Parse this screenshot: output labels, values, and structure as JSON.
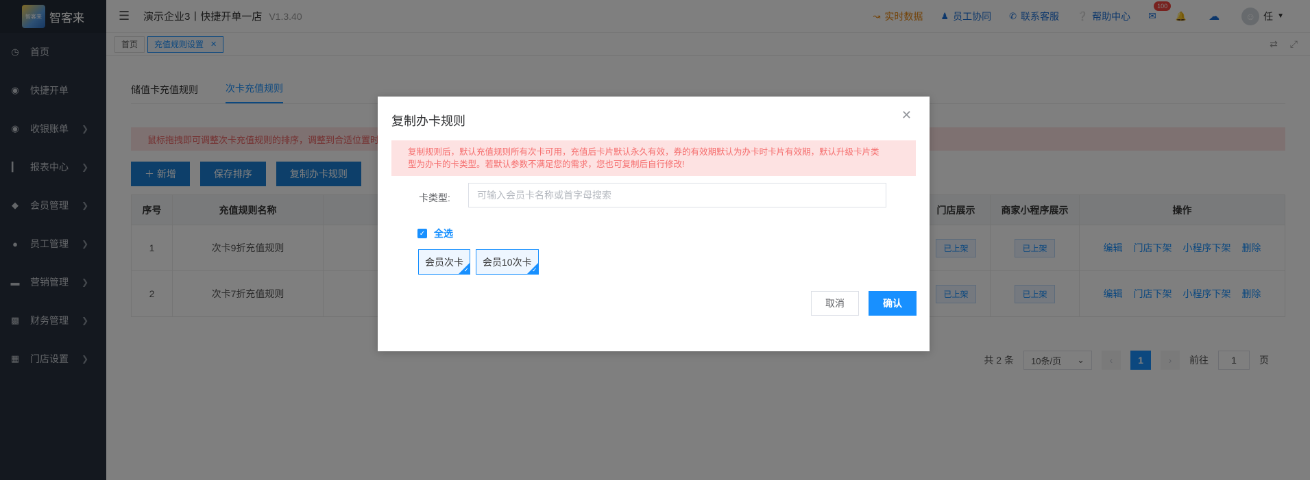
{
  "sidebar": {
    "logo_text": "智客来",
    "logo_badge": "智客来",
    "items": [
      {
        "label": "首页",
        "icon": "dashboard-icon",
        "chevron": false
      },
      {
        "label": "快捷开单",
        "icon": "bag-icon",
        "chevron": false
      },
      {
        "label": "收银账单",
        "icon": "bag-icon",
        "chevron": true
      },
      {
        "label": "报表中心",
        "icon": "bar-chart-icon",
        "chevron": true
      },
      {
        "label": "会员管理",
        "icon": "diamond-icon",
        "chevron": true
      },
      {
        "label": "员工管理",
        "icon": "user-icon",
        "chevron": true
      },
      {
        "label": "营销管理",
        "icon": "briefcase-icon",
        "chevron": true
      },
      {
        "label": "财务管理",
        "icon": "wallet-icon",
        "chevron": true
      },
      {
        "label": "门店设置",
        "icon": "grid-icon",
        "chevron": true
      }
    ]
  },
  "header": {
    "company": "演示企业3丨快捷开单一店",
    "version": "V1.3.40",
    "realtime": "实时数据",
    "staff": "员工协同",
    "support": "联系客服",
    "help": "帮助中心",
    "mail_badge": "100",
    "user": "任"
  },
  "tabs": [
    {
      "label": "首页",
      "active": false
    },
    {
      "label": "充值规则设置",
      "active": true
    }
  ],
  "content": {
    "subtabs": [
      "储值卡充值规则",
      "次卡充值规则"
    ],
    "alert": "鼠标拖拽即可调整次卡充值规则的排序，调整到合适位置时",
    "buttons": {
      "add": "＋ 新增",
      "save_sort": "保存排序",
      "copy": "复制办卡规则"
    },
    "table": {
      "headers": {
        "index": "序号",
        "name": "充值规则名称",
        "store_show": "门店展示",
        "mini_show": "商家小程序展示",
        "ops": "操作"
      },
      "rows": [
        {
          "index": "1",
          "name": "次卡9折充值规则",
          "store": "已上架",
          "mini": "已上架"
        },
        {
          "index": "2",
          "name": "次卡7折充值规则",
          "store": "已上架",
          "mini": "已上架"
        }
      ],
      "ops": {
        "edit": "编辑",
        "store_off": "门店下架",
        "mini_off": "小程序下架",
        "delete": "删除"
      }
    },
    "pager": {
      "total": "共 2 条",
      "size": "10条/页",
      "page": "1",
      "goto": "前往",
      "goto_value": "1",
      "unit": "页"
    }
  },
  "modal": {
    "title": "复制办卡规则",
    "alert_line1": "复制规则后，默认充值规则所有次卡可用，充值后卡片默认永久有效，券的有效期默认为办卡时卡片有效期，默认升级卡片类",
    "alert_line2": "型为办卡的卡类型。若默认参数不满足您的需求，您也可复制后自行修改!",
    "field_label": "卡类型:",
    "field_placeholder": "可输入会员卡名称或首字母搜索",
    "check_all": "全选",
    "cards": [
      "会员次卡",
      "会员10次卡"
    ],
    "cancel": "取消",
    "confirm": "确认"
  }
}
